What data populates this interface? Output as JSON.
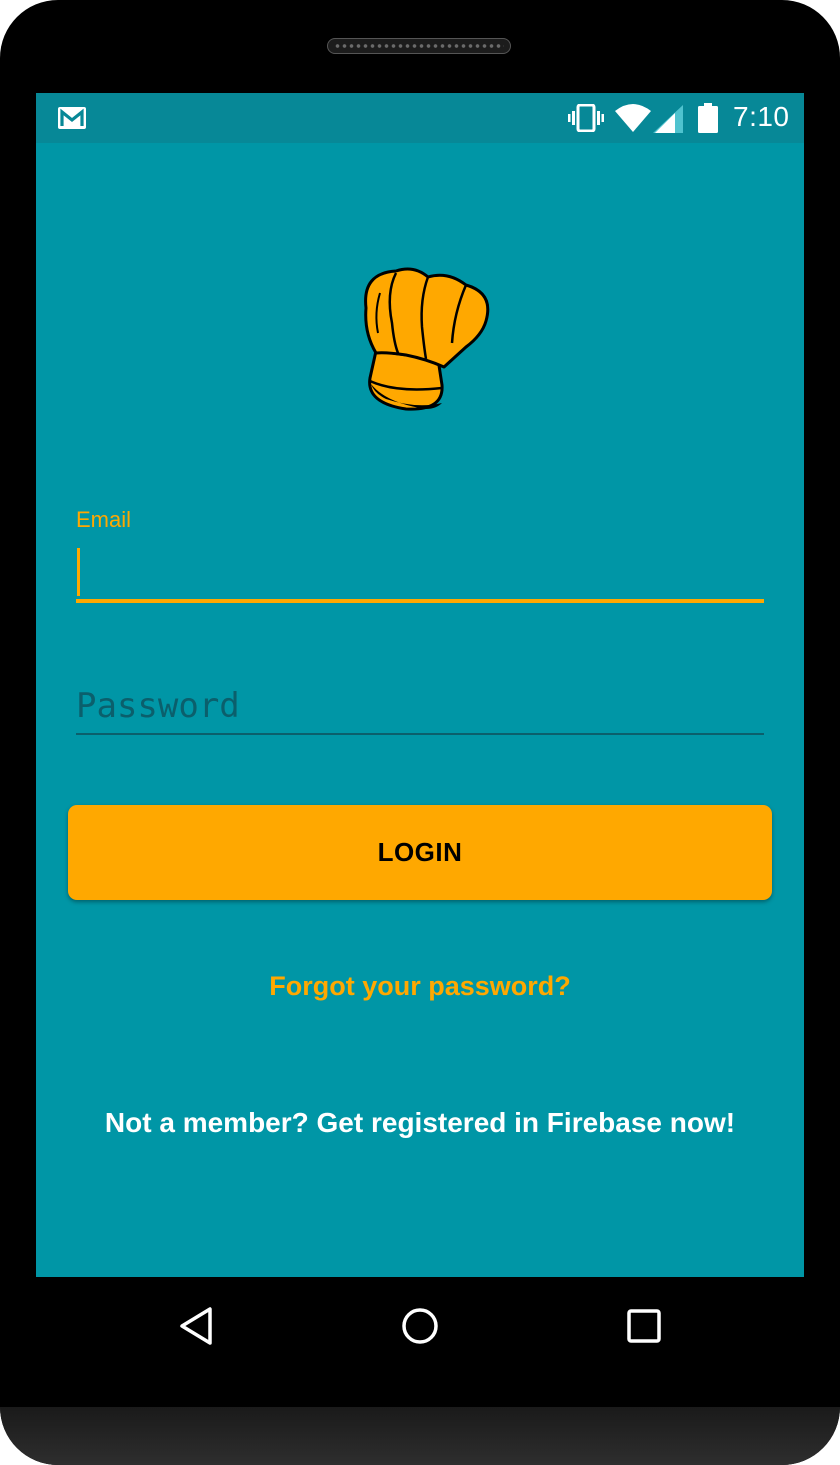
{
  "status_bar": {
    "time": "7:10",
    "icons": [
      "gmail-icon",
      "vibrate-icon",
      "wifi-icon",
      "cellular-signal-icon",
      "battery-icon"
    ]
  },
  "login": {
    "email_label": "Email",
    "email_value": "",
    "password_placeholder": "Password",
    "login_button": "LOGIN",
    "forgot_password": "Forgot your password?",
    "register_prompt": "Not a member? Get registered in Firebase now!"
  },
  "nav_bar": {
    "buttons": [
      "back-icon",
      "home-icon",
      "recents-icon"
    ]
  },
  "colors": {
    "background": "#0096a6",
    "status_bar": "#078897",
    "accent": "#ffa800",
    "hint_text": "#0b5f6c"
  }
}
